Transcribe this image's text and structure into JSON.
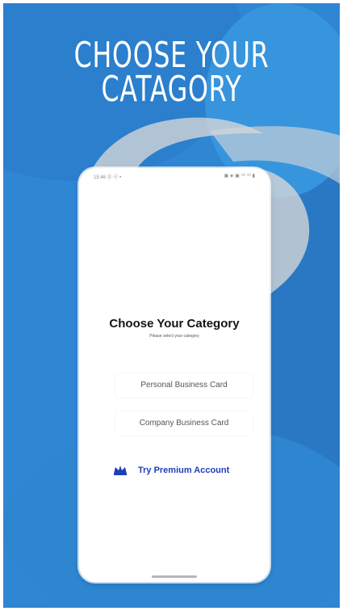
{
  "poster": {
    "title_line_1": "CHOOSE YOUR",
    "title_line_2": "CATAGORY",
    "background_color": "#2f86d3"
  },
  "status_bar": {
    "left_text": "15:46 ⓖ ⓔ •",
    "right_text": "▣ ◈ ▣ ⁵ᴳ ⁵ᴳ ▮"
  },
  "screen": {
    "title": "Choose Your Category",
    "subtitle": "Please select your category",
    "options": [
      "Personal Business Card",
      "Company Business Card"
    ],
    "premium_label": "Try Premium Account"
  },
  "icons": {
    "crown": "crown-icon"
  },
  "colors": {
    "premium_blue": "#1f3fb9",
    "text_dark": "#141414",
    "text_muted": "#555555",
    "phone_white": "#ffffff"
  }
}
